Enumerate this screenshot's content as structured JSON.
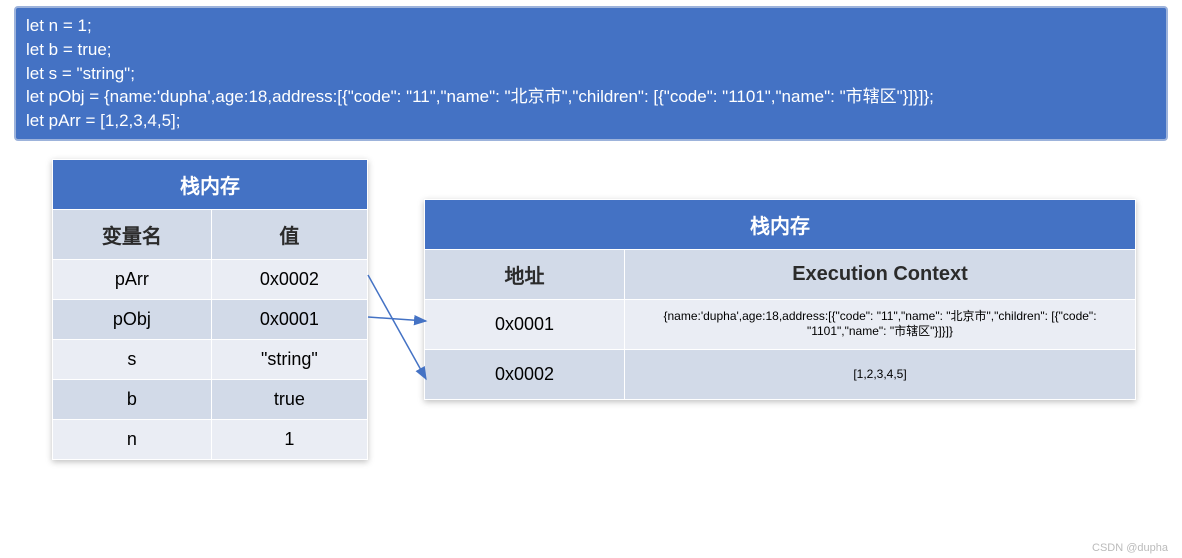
{
  "code": {
    "lines": [
      "let n = 1;",
      "let b = true;",
      "let s = \"string\";",
      "let pObj = {name:'dupha',age:18,address:[{\"code\": \"11\",\"name\": \"北京市\",\"children\": [{\"code\": \"1101\",\"name\": \"市辖区\"}]}]};",
      "let pArr = [1,2,3,4,5];"
    ]
  },
  "stack": {
    "title": "栈内存",
    "headers": {
      "var": "变量名",
      "val": "值"
    },
    "rows": [
      {
        "var": "pArr",
        "val": "0x0002"
      },
      {
        "var": "pObj",
        "val": "0x0001"
      },
      {
        "var": "s",
        "val": "\"string\""
      },
      {
        "var": "b",
        "val": "true"
      },
      {
        "var": "n",
        "val": "1"
      }
    ]
  },
  "heap": {
    "title": "栈内存",
    "headers": {
      "addr": "地址",
      "ctx": "Execution Context"
    },
    "rows": [
      {
        "addr": "0x0001",
        "ctx": "{name:'dupha',age:18,address:[{\"code\": \"11\",\"name\": \"北京市\",\"children\": [{\"code\": \"1101\",\"name\": \"市辖区\"}]}]}"
      },
      {
        "addr": "0x0002",
        "ctx": "[1,2,3,4,5]"
      }
    ]
  },
  "watermark": "CSDN @dupha",
  "chart_data": {
    "type": "table",
    "title": "JavaScript stack vs heap memory diagram",
    "stack_memory": [
      {
        "variable": "pArr",
        "value": "0x0002"
      },
      {
        "variable": "pObj",
        "value": "0x0001"
      },
      {
        "variable": "s",
        "value": "\"string\""
      },
      {
        "variable": "b",
        "value": "true"
      },
      {
        "variable": "n",
        "value": "1"
      }
    ],
    "heap_memory": [
      {
        "address": "0x0001",
        "execution_context": "{name:'dupha',age:18,address:[{\"code\": \"11\",\"name\": \"北京市\",\"children\": [{\"code\": \"1101\",\"name\": \"市辖区\"}]}]}"
      },
      {
        "address": "0x0002",
        "execution_context": "[1,2,3,4,5]"
      }
    ],
    "arrows": [
      {
        "from_stack_row": 0,
        "to_heap_row": 1,
        "meaning": "pArr → 0x0002"
      },
      {
        "from_stack_row": 1,
        "to_heap_row": 0,
        "meaning": "pObj → 0x0001"
      }
    ]
  }
}
